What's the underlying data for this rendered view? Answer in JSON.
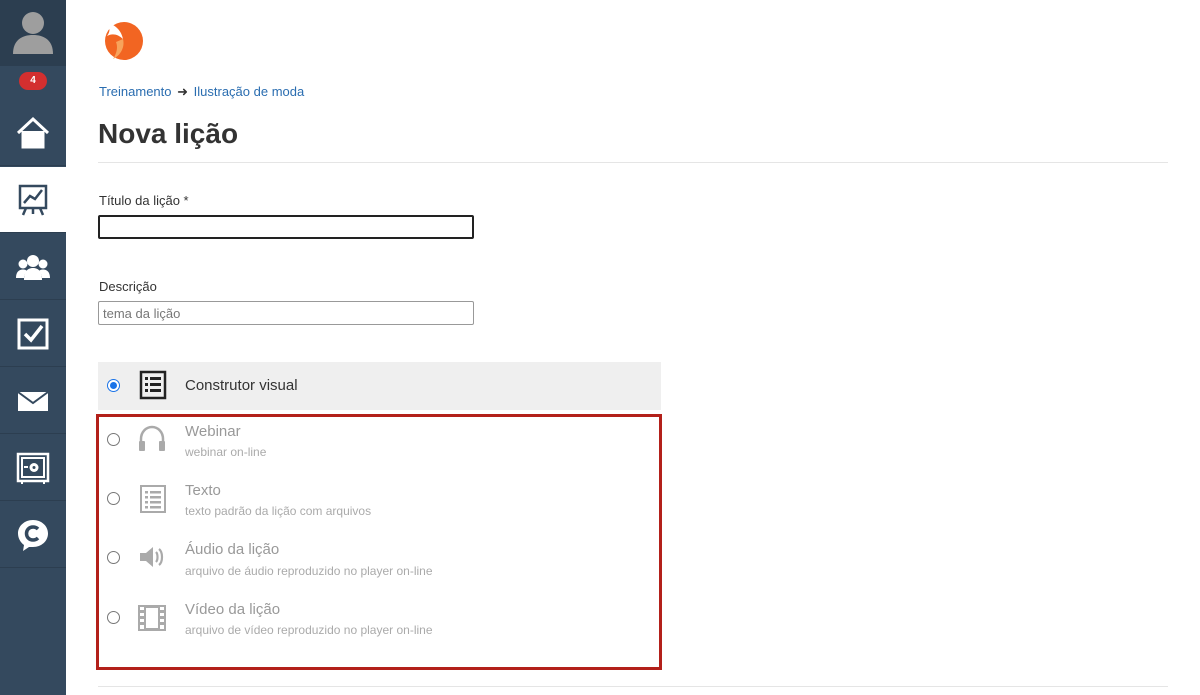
{
  "sidebar": {
    "notification_count": "4",
    "items": [
      {
        "icon": "home-icon"
      },
      {
        "icon": "training-chart-icon",
        "active": true
      },
      {
        "icon": "users-icon"
      },
      {
        "icon": "tasks-checkbox-icon"
      },
      {
        "icon": "mail-icon"
      },
      {
        "icon": "safe-icon"
      },
      {
        "icon": "chat-logo-icon"
      }
    ]
  },
  "breadcrumb": {
    "root": "Treinamento",
    "separator": "➜",
    "current": "Ilustração de moda"
  },
  "page": {
    "title": "Nova lição"
  },
  "form": {
    "title_label": "Título da lição *",
    "title_value": "",
    "description_label": "Descrição",
    "description_placeholder": "tema da lição"
  },
  "lesson_types": [
    {
      "title": "Construtor visual",
      "subtitle": "",
      "selected": true,
      "icon": "list-builder-icon"
    },
    {
      "title": "Webinar",
      "subtitle": "webinar on-line",
      "selected": false,
      "icon": "headphones-icon"
    },
    {
      "title": "Texto",
      "subtitle": "texto padrão da lição com arquivos",
      "selected": false,
      "icon": "text-document-icon"
    },
    {
      "title": "Áudio da lição",
      "subtitle": "arquivo de áudio reproduzido no player on-line",
      "selected": false,
      "icon": "speaker-icon"
    },
    {
      "title": "Vídeo da lição",
      "subtitle": "arquivo de vídeo reproduzido no player on-line",
      "selected": false,
      "icon": "film-icon"
    }
  ],
  "colors": {
    "sidebar": "#34495e",
    "link": "#2a6db0",
    "highlight_border": "#b3201a",
    "radio_selected": "#1a73e8",
    "badge": "#d32f2f",
    "logo_orange": "#f26522"
  }
}
